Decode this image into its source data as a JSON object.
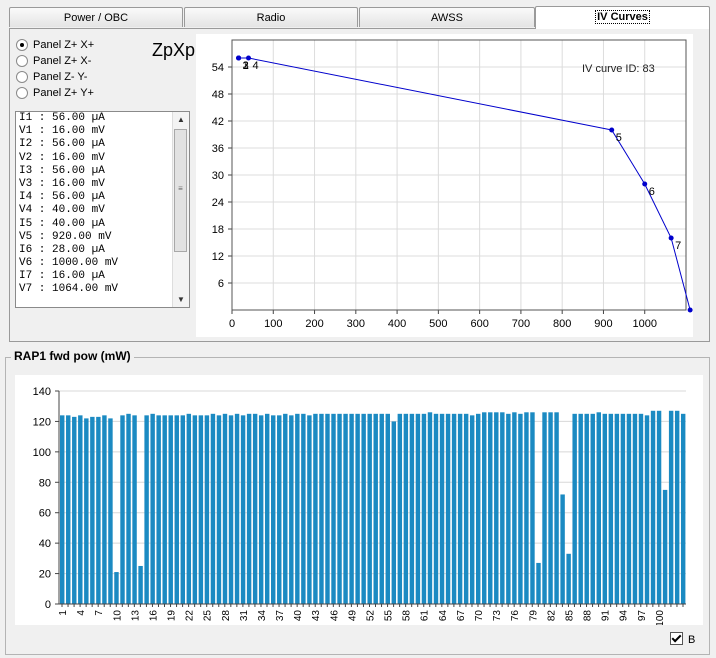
{
  "tabs": [
    {
      "label": "Power / OBC",
      "active": false
    },
    {
      "label": "Radio",
      "active": false
    },
    {
      "label": "AWSS",
      "active": false
    },
    {
      "label": "IV Curves",
      "active": true
    }
  ],
  "panels": [
    {
      "label": "Panel Z+ X+",
      "checked": true
    },
    {
      "label": "Panel Z+ X-",
      "checked": false
    },
    {
      "label": "Panel Z- Y-",
      "checked": false
    },
    {
      "label": "Panel Z+ Y+",
      "checked": false
    }
  ],
  "panel_title": "ZpXp",
  "readings": [
    "I1 : 56.00 µA",
    "V1 : 16.00 mV",
    "I2 : 56.00 µA",
    "V2 : 16.00 mV",
    "I3 : 56.00 µA",
    "V3 : 16.00 mV",
    "I4 : 56.00 µA",
    "V4 : 40.00 mV",
    "I5 : 40.00 µA",
    "V5 : 920.00 mV",
    "I6 : 28.00 µA",
    "V6 : 1000.00 mV",
    "I7 : 16.00 µA",
    "V7 : 1064.00 mV"
  ],
  "scroll": {
    "up": "▲",
    "down": "▼",
    "grip": "≡"
  },
  "iv_chart": {
    "annotation": "IV curve ID: 83",
    "color": "#0000cc",
    "xlim": [
      0,
      1100
    ],
    "ylim": [
      0,
      60
    ],
    "x_ticks": [
      0,
      100,
      200,
      300,
      400,
      500,
      600,
      700,
      800,
      900,
      1000
    ],
    "y_ticks": [
      6,
      12,
      18,
      24,
      30,
      36,
      42,
      48,
      54
    ],
    "points": [
      {
        "x": 16,
        "y": 56,
        "label": "1"
      },
      {
        "x": 16,
        "y": 56,
        "label": "2"
      },
      {
        "x": 16,
        "y": 56,
        "label": "3"
      },
      {
        "x": 40,
        "y": 56,
        "label": "4"
      },
      {
        "x": 920,
        "y": 40,
        "label": "5"
      },
      {
        "x": 1000,
        "y": 28,
        "label": "6"
      },
      {
        "x": 1064,
        "y": 16,
        "label": "7"
      },
      {
        "x": 1110,
        "y": 0,
        "label": ""
      }
    ]
  },
  "power_section": {
    "title": "RAP1 fwd pow (mW)"
  },
  "chart_data": {
    "type": "bar",
    "color": "#1b8ac2",
    "ylim": [
      0,
      140
    ],
    "y_ticks": [
      0,
      20,
      40,
      60,
      80,
      100,
      120,
      140
    ],
    "x_tick_labels": [
      "1",
      "4",
      "7",
      "10",
      "13",
      "16",
      "19",
      "22",
      "25",
      "28",
      "31",
      "34",
      "37",
      "40",
      "43",
      "46",
      "49",
      "52",
      "55",
      "58",
      "61",
      "64",
      "67",
      "70",
      "73",
      "76",
      "79",
      "82",
      "85",
      "88",
      "91",
      "94",
      "97",
      "100"
    ],
    "categories": [
      1,
      2,
      3,
      4,
      5,
      6,
      7,
      8,
      9,
      10,
      11,
      12,
      13,
      14,
      15,
      16,
      17,
      18,
      19,
      20,
      21,
      22,
      23,
      24,
      25,
      26,
      27,
      28,
      29,
      30,
      31,
      32,
      33,
      34,
      35,
      36,
      37,
      38,
      39,
      40,
      41,
      42,
      43,
      44,
      45,
      46,
      47,
      48,
      49,
      50,
      51,
      52,
      53,
      54,
      55,
      56,
      57,
      58,
      59,
      60,
      61,
      62,
      63,
      64,
      65,
      66,
      67,
      68,
      69,
      70,
      71,
      72,
      73,
      74,
      75,
      76,
      77,
      78,
      79,
      80,
      81,
      82,
      83,
      84,
      85,
      86,
      87,
      88,
      89,
      90,
      91,
      92,
      93,
      94,
      95,
      96,
      97,
      98,
      99,
      100,
      101
    ],
    "values": [
      124,
      124,
      123,
      124,
      122,
      123,
      123,
      124,
      122,
      21,
      124,
      125,
      124,
      25,
      124,
      125,
      124,
      124,
      124,
      124,
      124,
      125,
      124,
      124,
      124,
      125,
      124,
      125,
      124,
      125,
      124,
      125,
      125,
      124,
      125,
      124,
      124,
      125,
      124,
      125,
      125,
      124,
      125,
      125,
      125,
      125,
      125,
      125,
      125,
      125,
      125,
      125,
      125,
      125,
      125,
      120,
      125,
      125,
      125,
      125,
      125,
      126,
      125,
      125,
      125,
      125,
      125,
      125,
      124,
      125,
      126,
      126,
      126,
      126,
      125,
      126,
      125,
      126,
      126,
      27,
      126,
      126,
      126,
      72,
      33,
      125,
      125,
      125,
      125,
      126,
      125,
      125,
      125,
      125,
      125,
      125,
      125,
      124,
      127,
      127,
      75,
      127,
      127,
      125
    ]
  },
  "legend": {
    "label": "B",
    "checked": true
  }
}
